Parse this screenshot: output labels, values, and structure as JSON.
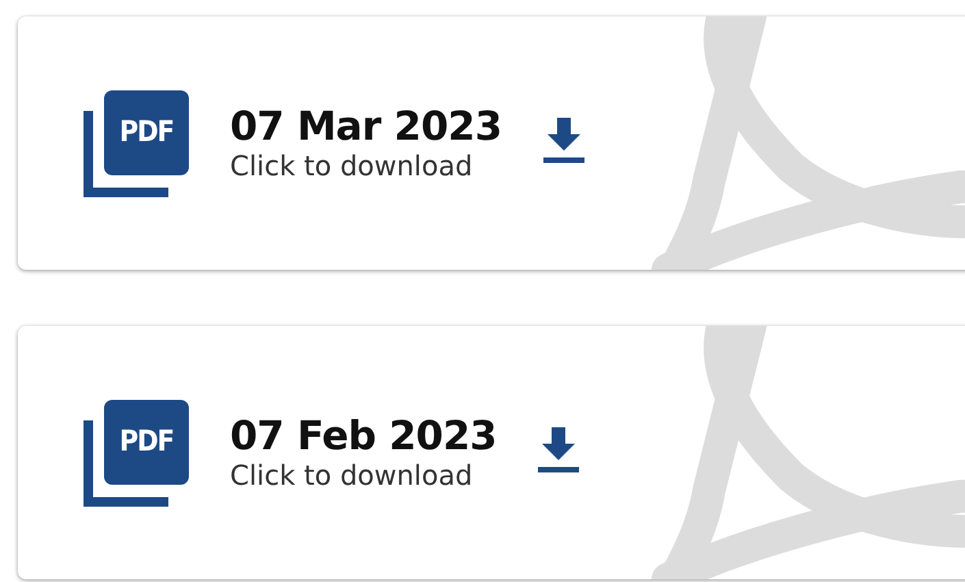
{
  "documents": [
    {
      "icon_label": "PDF",
      "date": "07 Mar 2023",
      "action": "Click to download"
    },
    {
      "icon_label": "PDF",
      "date": "07 Feb 2023",
      "action": "Click to download"
    }
  ]
}
